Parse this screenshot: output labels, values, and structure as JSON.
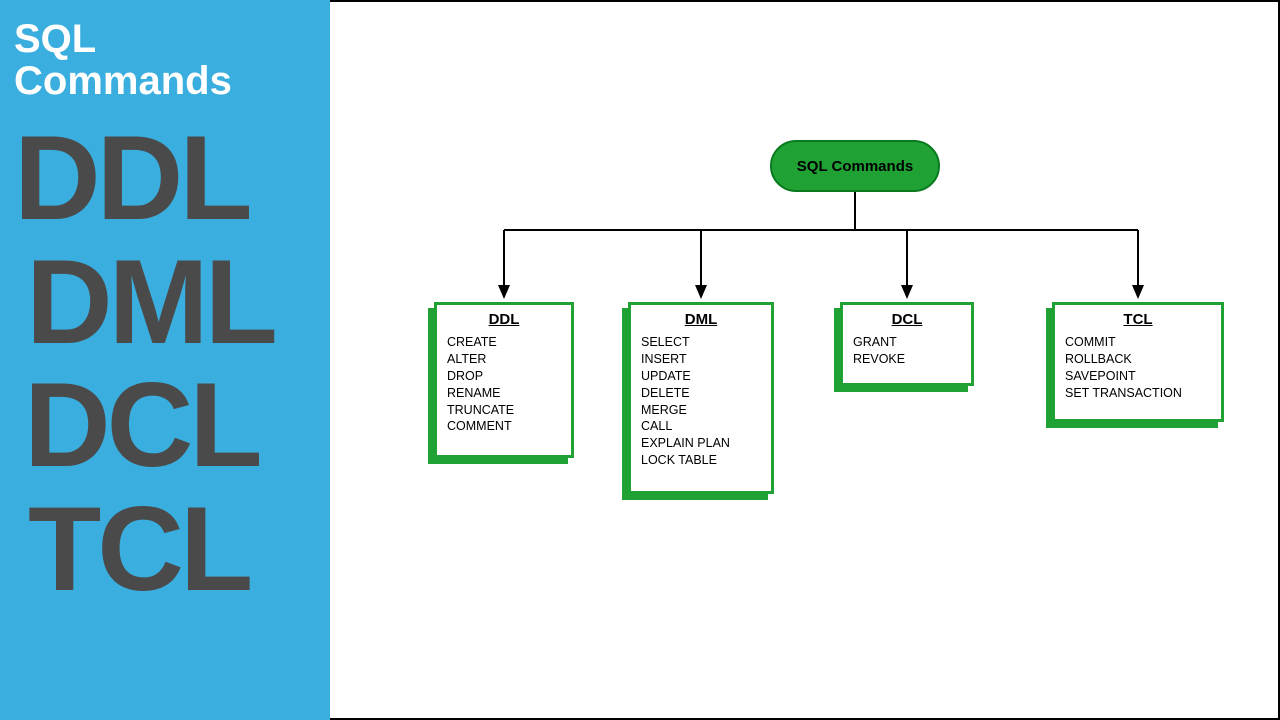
{
  "left": {
    "title": "SQL Commands",
    "words": [
      "DDL",
      "DML",
      "DCL",
      "TCL"
    ]
  },
  "diagram": {
    "root_label": "SQL Commands",
    "categories": [
      {
        "key": "ddl",
        "title": "DDL",
        "items": [
          "CREATE",
          "ALTER",
          "DROP",
          "RENAME",
          "TRUNCATE",
          "COMMENT"
        ]
      },
      {
        "key": "dml",
        "title": "DML",
        "items": [
          "SELECT",
          "INSERT",
          "UPDATE",
          "DELETE",
          "MERGE",
          "CALL",
          "EXPLAIN PLAN",
          "LOCK TABLE"
        ]
      },
      {
        "key": "dcl",
        "title": "DCL",
        "items": [
          "GRANT",
          "REVOKE"
        ]
      },
      {
        "key": "tcl",
        "title": "TCL",
        "items": [
          "COMMIT",
          "ROLLBACK",
          "SAVEPOINT",
          "SET TRANSACTION"
        ]
      }
    ]
  }
}
